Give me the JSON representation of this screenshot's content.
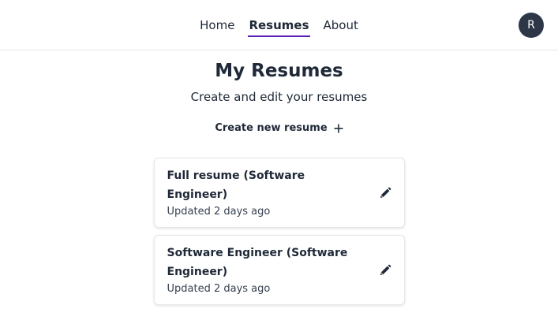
{
  "nav": {
    "items": [
      {
        "label": "Home",
        "active": false
      },
      {
        "label": "Resumes",
        "active": true
      },
      {
        "label": "About",
        "active": false
      }
    ],
    "avatar_initial": "R",
    "accent_color": "#5b21b6"
  },
  "main": {
    "title": "My Resumes",
    "subtitle": "Create and edit your resumes",
    "create_label": "Create new resume",
    "create_icon": "plus-icon"
  },
  "resumes": [
    {
      "title": "Full resume (Software Engineer)",
      "updated": "Updated 2 days ago",
      "icon": "pencil-icon"
    },
    {
      "title": "Software Engineer (Software Engineer)",
      "updated": "Updated 2 days ago",
      "icon": "pencil-icon"
    }
  ]
}
